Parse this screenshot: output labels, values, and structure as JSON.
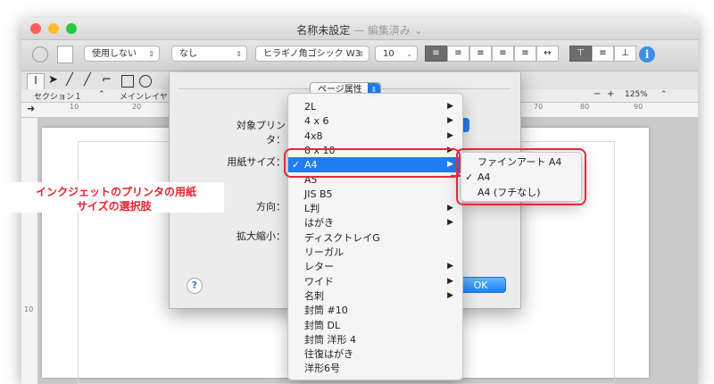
{
  "window": {
    "title": "名称未設定",
    "title_sep": " — ",
    "title_status": "編集済み ⌄",
    "colors": {
      "close": "#fc5f57",
      "minimize": "#fdbc2e",
      "zoom": "#28c840"
    }
  },
  "toolbar": {
    "popup_1": "使用しない",
    "popup_2": "なし",
    "font_popup": "ヒラギノ角ゴシック W3",
    "size_popup": "10",
    "info_icon": "i"
  },
  "sectionbar": {
    "section": "セクション１",
    "layer": "メインレイヤ",
    "zoom_minus": "−",
    "zoom_plus": "+",
    "zoom": "125%"
  },
  "rulers": {
    "marks": [
      "10",
      "20",
      "70",
      "80",
      "90"
    ],
    "vmark": "10"
  },
  "dialog": {
    "tab": "ページ属性",
    "printer_label": "対象プリンタ：",
    "paper_label": "用紙サイズ：",
    "orientation_label": "方向：",
    "scale_label": "拡大縮小：",
    "ok": "OK",
    "help": "?"
  },
  "menu": {
    "items": [
      {
        "label": "2L",
        "sub": true,
        "sel": false,
        "chk": false
      },
      {
        "label": "4 x 6",
        "sub": true,
        "sel": false,
        "chk": false
      },
      {
        "label": "4x8",
        "sub": true,
        "sel": false,
        "chk": false
      },
      {
        "label": "8 x 10",
        "sub": true,
        "sel": false,
        "chk": false
      },
      {
        "label": "A4",
        "sub": true,
        "sel": true,
        "chk": true
      },
      {
        "label": "A5",
        "sub": false,
        "sel": false,
        "chk": false
      },
      {
        "label": "JIS B5",
        "sub": false,
        "sel": false,
        "chk": false
      },
      {
        "label": "L判",
        "sub": true,
        "sel": false,
        "chk": false
      },
      {
        "label": "はがき",
        "sub": true,
        "sel": false,
        "chk": false
      },
      {
        "label": "ディスクトレイG",
        "sub": false,
        "sel": false,
        "chk": false
      },
      {
        "label": "リーガル",
        "sub": false,
        "sel": false,
        "chk": false
      },
      {
        "label": "レター",
        "sub": true,
        "sel": false,
        "chk": false
      },
      {
        "label": "ワイド",
        "sub": true,
        "sel": false,
        "chk": false
      },
      {
        "label": "名刺",
        "sub": true,
        "sel": false,
        "chk": false
      },
      {
        "label": "封筒 #10",
        "sub": false,
        "sel": false,
        "chk": false
      },
      {
        "label": "封筒 DL",
        "sub": false,
        "sel": false,
        "chk": false
      },
      {
        "label": "封筒 洋形 4",
        "sub": false,
        "sel": false,
        "chk": false
      },
      {
        "label": "往復はがき",
        "sub": false,
        "sel": false,
        "chk": false
      },
      {
        "label": "洋形6号",
        "sub": false,
        "sel": false,
        "chk": false
      }
    ],
    "check_mark": "✓",
    "submenu_arrow": "▶"
  },
  "submenu": {
    "items": [
      {
        "label": "ファインアート A4",
        "chk": false
      },
      {
        "label": "A4",
        "chk": true
      },
      {
        "label": "A4 (フチなし)",
        "chk": false
      }
    ]
  },
  "callout": {
    "line1": "インクジェットのプリンタの用紙",
    "line2": "サイズの選択肢",
    "color": "#e8232f"
  }
}
